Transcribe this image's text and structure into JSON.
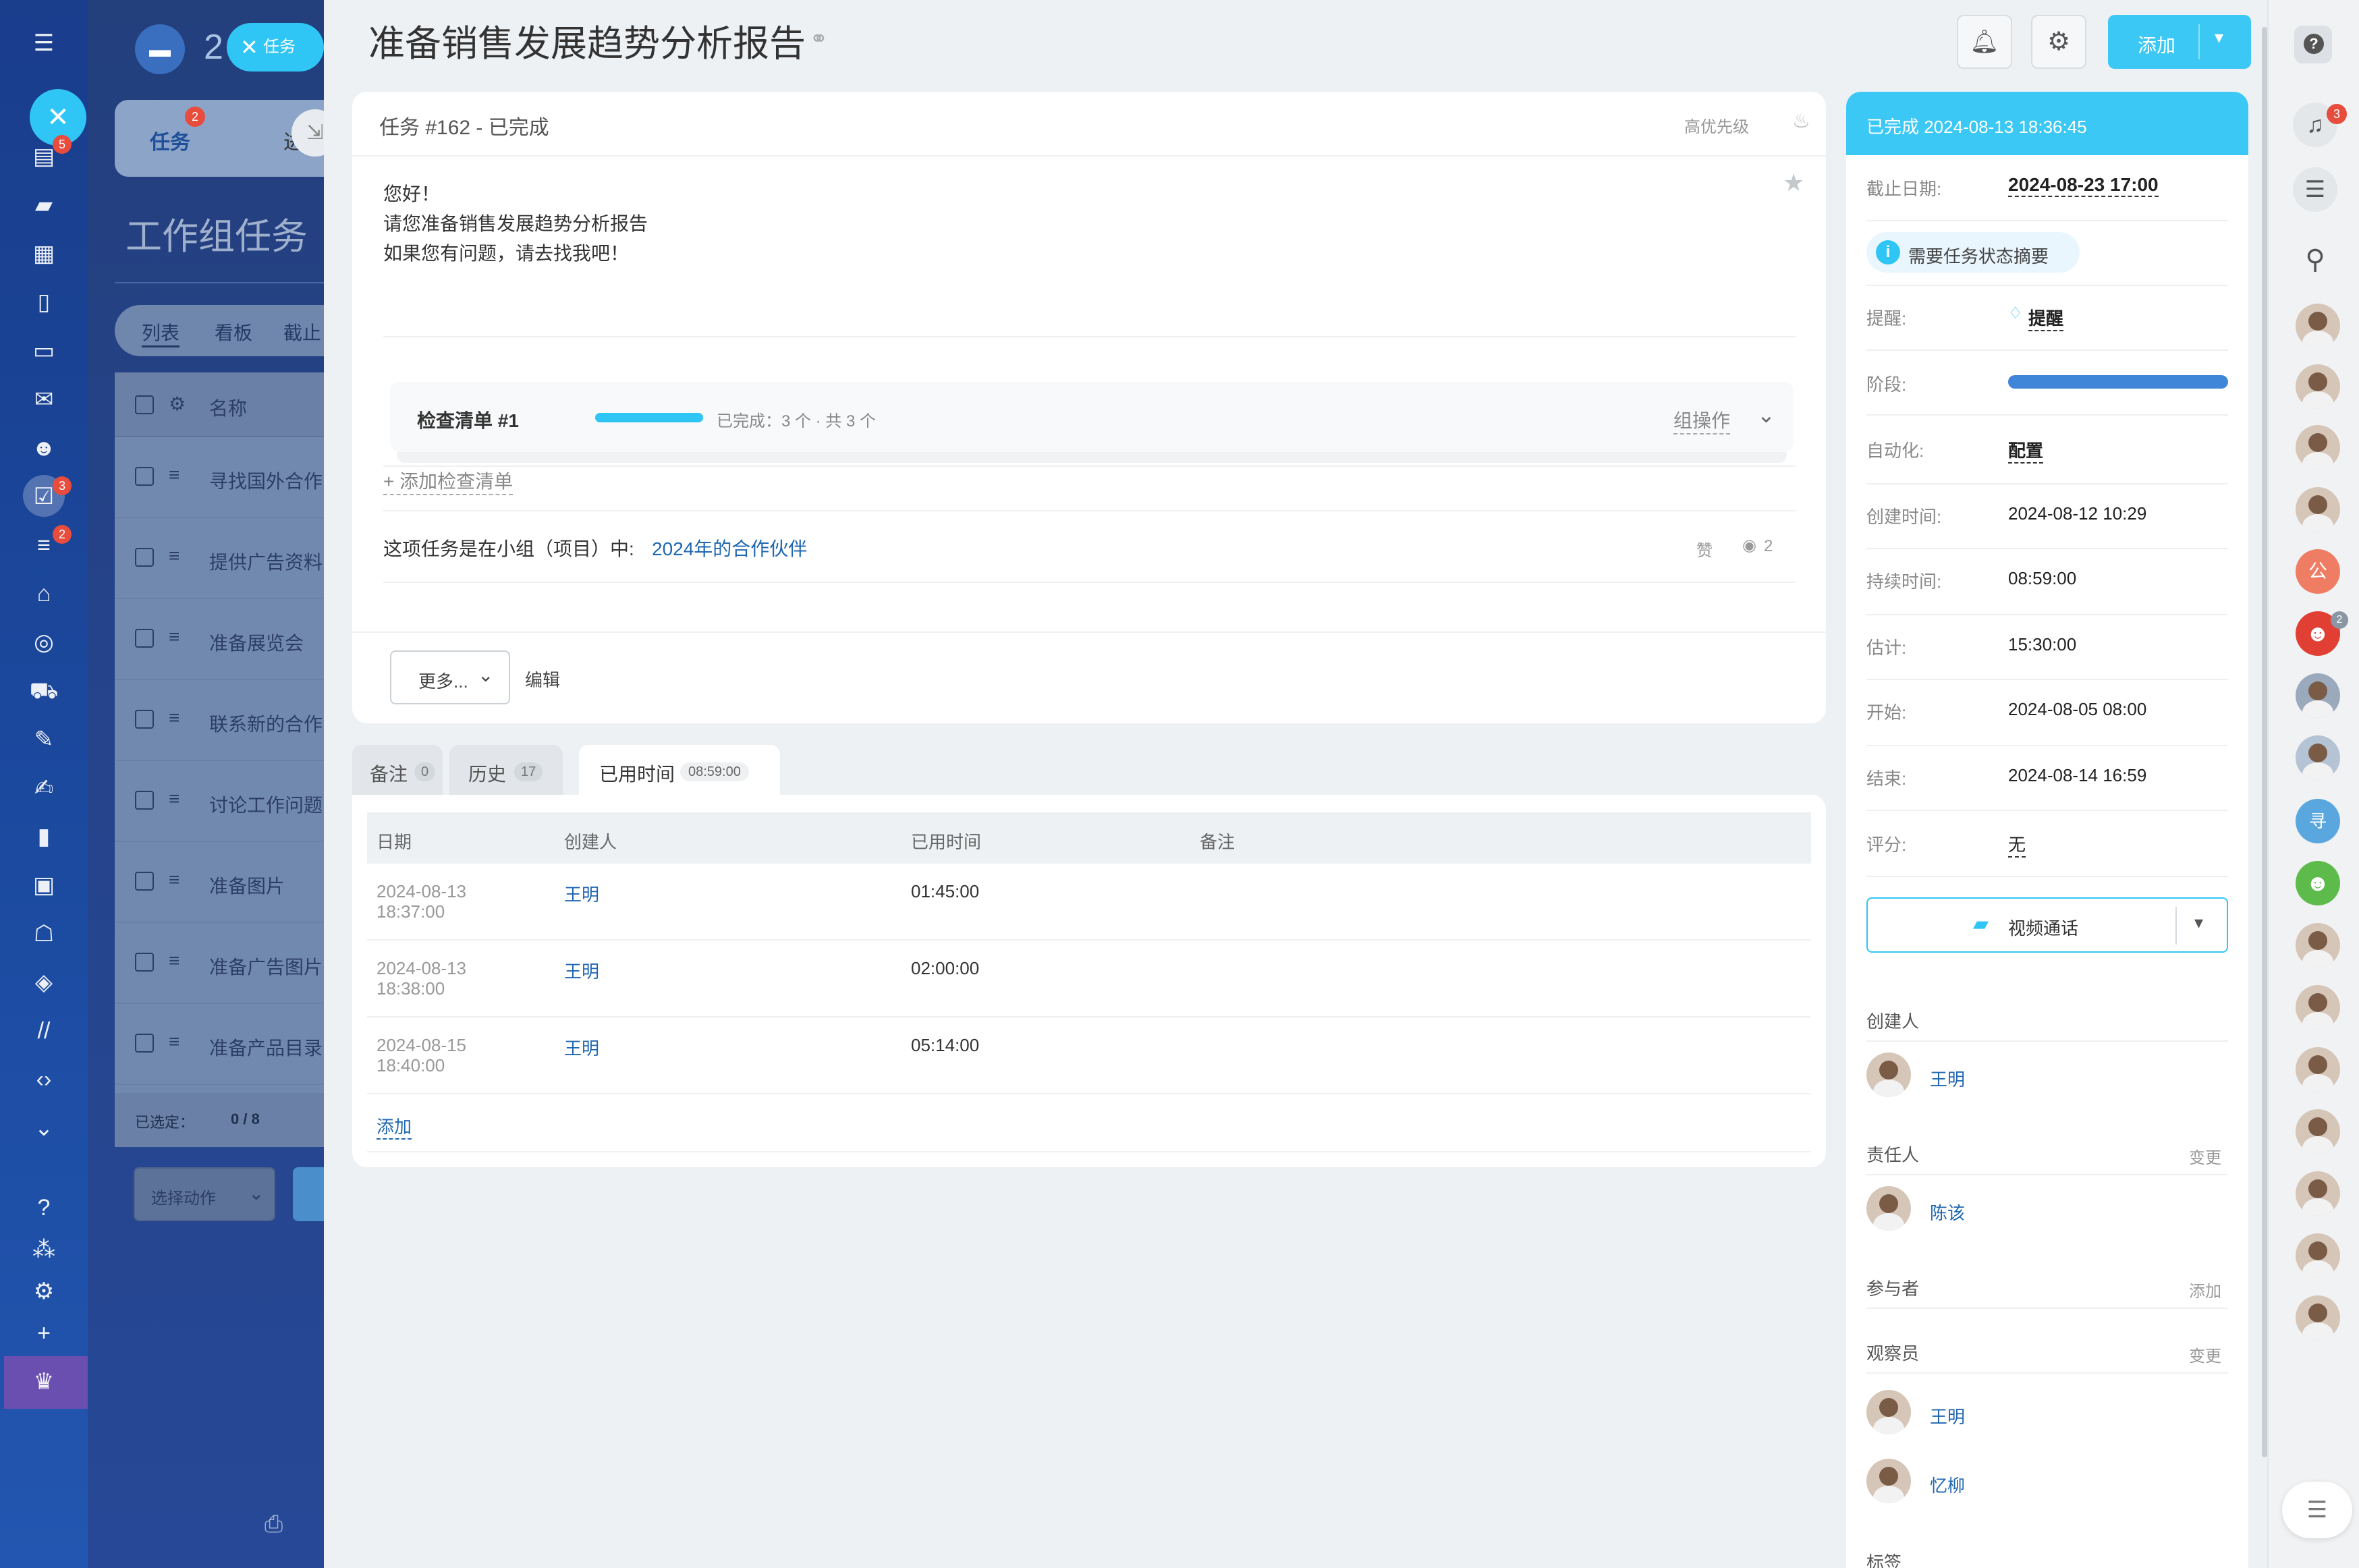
{
  "left_rail": {
    "icons": [
      "menu-icon",
      "close-icon",
      "calendar-icon",
      "chat-icon",
      "schedule-icon",
      "document-icon",
      "drive-icon",
      "mail-icon",
      "group-icon",
      "task-icon",
      "filter-icon",
      "bank-icon",
      "target-icon",
      "cart-icon",
      "sign-icon",
      "pen-icon",
      "chart-icon",
      "vcard-icon",
      "robot-icon",
      "box-icon",
      "brand-icon",
      "code-icon",
      "chevron-icon",
      "help-icon",
      "sitemap-icon",
      "gear-icon",
      "plus-icon",
      "crown-icon"
    ],
    "badges": {
      "calendar": "5",
      "task": "3",
      "filter": "2"
    }
  },
  "behind": {
    "tab_task_label": "任务",
    "tab_task_badge": "2",
    "tab_other_label": "进",
    "page_title": "工作组任务",
    "view_tabs": [
      "列表",
      "看板",
      "截止"
    ],
    "column_name": "名称",
    "rows": [
      "寻找国外合作",
      "提供广告资料",
      "准备展览会",
      "联系新的合作",
      "讨论工作问题",
      "准备图片",
      "准备广告图片",
      "准备产品目录"
    ],
    "selected_label": "已选定：",
    "selected_value": "0 / 8",
    "action_select": "选择动作",
    "floating_task_label": "任务",
    "partial_title": "2"
  },
  "header": {
    "title": "准备销售发展趋势分析报告",
    "add_button": "添加"
  },
  "task": {
    "heading": "任务 #162 - 已完成",
    "priority": "高优先级",
    "body_lines": [
      "您好！",
      "请您准备销售发展趋势分析报告",
      "如果您有问题，请去找我吧！"
    ],
    "checklist": {
      "title": "检查清单 #1",
      "progress_text": "已完成：3 个 · 共 3 个",
      "progress": 1.0,
      "group_action": "组操作"
    },
    "add_checklist": "+ 添加检查清单",
    "project_prefix": "这项任务是在小组（项目）中:",
    "project_link": "2024年的合作伙伴",
    "like_label": "赞",
    "views": "2",
    "more_button": "更多...",
    "edit_button": "编辑"
  },
  "tabs": [
    {
      "label": "备注",
      "count": "0"
    },
    {
      "label": "历史",
      "count": "17"
    },
    {
      "label": "已用时间",
      "count": "08:59:00"
    }
  ],
  "time_table": {
    "headers": [
      "日期",
      "创建人",
      "已用时间",
      "备注"
    ],
    "rows": [
      {
        "date": "2024-08-13",
        "time": "18:37:00",
        "creator": "王明",
        "spent": "01:45:00"
      },
      {
        "date": "2024-08-13",
        "time": "18:38:00",
        "creator": "王明",
        "spent": "02:00:00"
      },
      {
        "date": "2024-08-15",
        "time": "18:40:00",
        "creator": "王明",
        "spent": "05:14:00"
      }
    ],
    "add_link": "添加"
  },
  "sidebar": {
    "status_header": "已完成 2024-08-13 18:36:45",
    "deadline_label": "截止日期:",
    "deadline_value": "2024-08-23 17:00",
    "summary_chip": "需要任务状态摘要",
    "reminder_label": "提醒:",
    "reminder_value": "提醒",
    "stage_label": "阶段:",
    "automation_label": "自动化:",
    "automation_value": "配置",
    "created_label": "创建时间:",
    "created_value": "2024-08-12 10:29",
    "duration_label": "持续时间:",
    "duration_value": "08:59:00",
    "estimate_label": "估计:",
    "estimate_value": "15:30:00",
    "start_label": "开始:",
    "start_value": "2024-08-05 08:00",
    "end_label": "结束:",
    "end_value": "2024-08-14 16:59",
    "rating_label": "评分:",
    "rating_value": "无",
    "video_call": "视频通话",
    "creator_title": "创建人",
    "creator_name": "王明",
    "responsible_title": "责任人",
    "responsible_action": "变更",
    "responsible_name": "陈该",
    "participants_title": "参与者",
    "participants_action": "添加",
    "observers_title": "观察员",
    "observers_action": "变更",
    "observers": [
      "王明",
      "忆柳"
    ],
    "tags_title": "标签"
  },
  "right_rail": {
    "notification_badge": "3",
    "group_badge": "2",
    "letter_public": "公",
    "letter_find": "寻"
  },
  "colors": {
    "accent": "#2fc6f6",
    "link": "#2067b0",
    "stage": "#3f86d8",
    "badge": "#e74c3c"
  }
}
